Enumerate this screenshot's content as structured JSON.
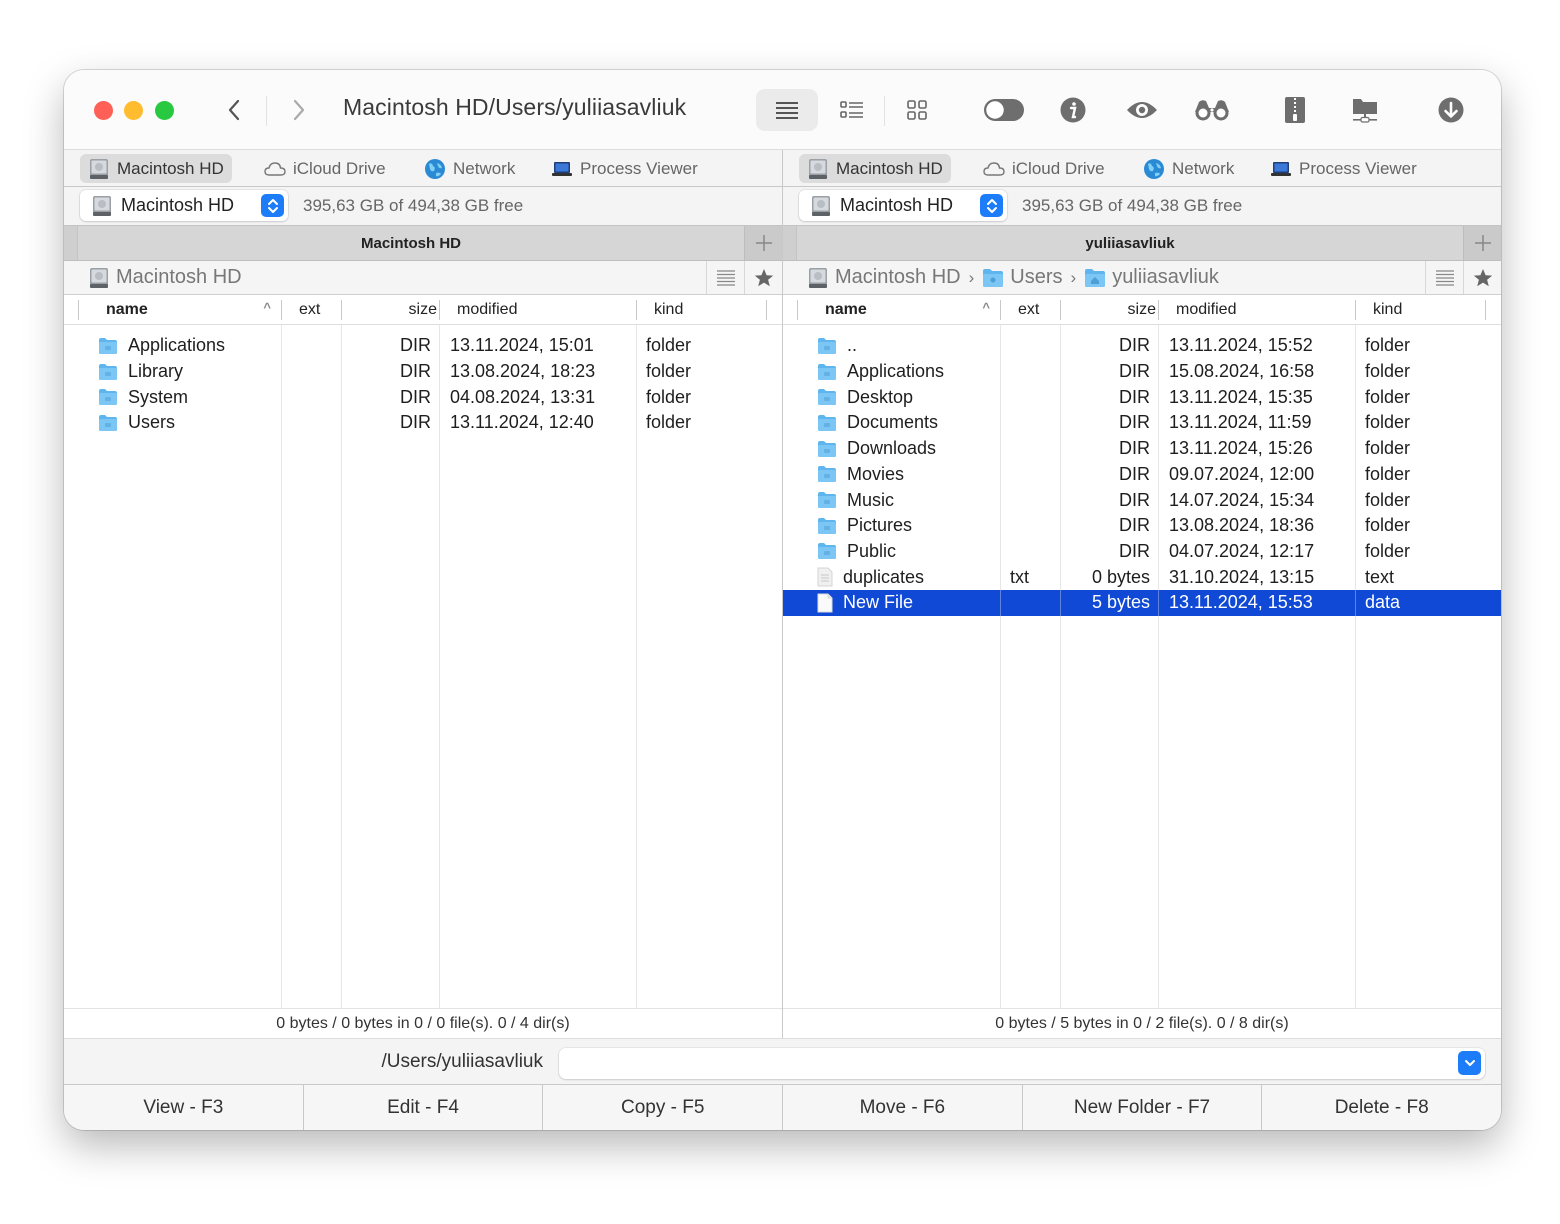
{
  "window": {
    "title_path": "Macintosh HD/Users/yuliiasavliuk",
    "toolbar": [
      {
        "name": "view-brief-icon",
        "active": true
      },
      {
        "name": "view-detailed-icon",
        "active": false
      },
      {
        "name": "view-thumbnails-icon",
        "active": false
      },
      {
        "name": "toggle-hidden-icon",
        "active": false
      },
      {
        "name": "info-icon",
        "active": false
      },
      {
        "name": "quick-look-icon",
        "active": false
      },
      {
        "name": "binoculars-search-icon",
        "active": false
      },
      {
        "name": "archive-icon",
        "active": false
      },
      {
        "name": "network-share-icon",
        "active": false
      },
      {
        "name": "download-icon",
        "active": false
      }
    ]
  },
  "panes": {
    "left": {
      "drive_tabs": [
        {
          "label": "Macintosh HD",
          "icon": "disk-icon",
          "active": true
        },
        {
          "label": "iCloud Drive",
          "icon": "cloud-icon",
          "active": false
        },
        {
          "label": "Network",
          "icon": "globe-icon",
          "active": false
        },
        {
          "label": "Process Viewer",
          "icon": "laptop-icon",
          "active": false
        }
      ],
      "volume": {
        "name": "Macintosh HD",
        "free": "395,63 GB of 494,38 GB free"
      },
      "tab_title": "Macintosh HD",
      "breadcrumb": [
        {
          "label": "Macintosh HD",
          "icon": "disk-icon"
        }
      ],
      "columns": {
        "name": "name",
        "ext": "ext",
        "size": "size",
        "modified": "modified",
        "kind": "kind"
      },
      "rows": [
        {
          "name": "Applications",
          "ext": "",
          "size": "DIR",
          "modified": "13.11.2024, 15:01",
          "kind": "folder",
          "icon": "folder-icon",
          "selected": false
        },
        {
          "name": "Library",
          "ext": "",
          "size": "DIR",
          "modified": "13.08.2024, 18:23",
          "kind": "folder",
          "icon": "folder-icon",
          "selected": false
        },
        {
          "name": "System",
          "ext": "",
          "size": "DIR",
          "modified": "04.08.2024, 13:31",
          "kind": "folder",
          "icon": "folder-icon",
          "selected": false
        },
        {
          "name": "Users",
          "ext": "",
          "size": "DIR",
          "modified": "13.11.2024, 12:40",
          "kind": "folder",
          "icon": "folder-icon",
          "selected": false
        }
      ],
      "status": "0 bytes / 0 bytes in 0 / 0 file(s). 0 / 4 dir(s)"
    },
    "right": {
      "drive_tabs": [
        {
          "label": "Macintosh HD",
          "icon": "disk-icon",
          "active": true
        },
        {
          "label": "iCloud Drive",
          "icon": "cloud-icon",
          "active": false
        },
        {
          "label": "Network",
          "icon": "globe-icon",
          "active": false
        },
        {
          "label": "Process Viewer",
          "icon": "laptop-icon",
          "active": false
        }
      ],
      "volume": {
        "name": "Macintosh HD",
        "free": "395,63 GB of 494,38 GB free"
      },
      "tab_title": "yuliiasavliuk",
      "breadcrumb": [
        {
          "label": "Macintosh HD",
          "icon": "disk-icon"
        },
        {
          "label": "Users",
          "icon": "folder-icon"
        },
        {
          "label": "yuliiasavliuk",
          "icon": "folder-icon"
        }
      ],
      "columns": {
        "name": "name",
        "ext": "ext",
        "size": "size",
        "modified": "modified",
        "kind": "kind"
      },
      "rows": [
        {
          "name": "..",
          "ext": "",
          "size": "DIR",
          "modified": "13.11.2024, 15:52",
          "kind": "folder",
          "icon": "folder-icon",
          "selected": false
        },
        {
          "name": "Applications",
          "ext": "",
          "size": "DIR",
          "modified": "15.08.2024, 16:58",
          "kind": "folder",
          "icon": "folder-icon",
          "selected": false
        },
        {
          "name": "Desktop",
          "ext": "",
          "size": "DIR",
          "modified": "13.11.2024, 15:35",
          "kind": "folder",
          "icon": "folder-icon",
          "selected": false
        },
        {
          "name": "Documents",
          "ext": "",
          "size": "DIR",
          "modified": "13.11.2024, 11:59",
          "kind": "folder",
          "icon": "folder-icon",
          "selected": false
        },
        {
          "name": "Downloads",
          "ext": "",
          "size": "DIR",
          "modified": "13.11.2024, 15:26",
          "kind": "folder",
          "icon": "folder-icon",
          "selected": false
        },
        {
          "name": "Movies",
          "ext": "",
          "size": "DIR",
          "modified": "09.07.2024, 12:00",
          "kind": "folder",
          "icon": "folder-icon",
          "selected": false
        },
        {
          "name": "Music",
          "ext": "",
          "size": "DIR",
          "modified": "14.07.2024, 15:34",
          "kind": "folder",
          "icon": "folder-icon",
          "selected": false
        },
        {
          "name": "Pictures",
          "ext": "",
          "size": "DIR",
          "modified": "13.08.2024, 18:36",
          "kind": "folder",
          "icon": "folder-icon",
          "selected": false
        },
        {
          "name": "Public",
          "ext": "",
          "size": "DIR",
          "modified": "04.07.2024, 12:17",
          "kind": "folder",
          "icon": "folder-icon",
          "selected": false
        },
        {
          "name": "duplicates",
          "ext": "txt",
          "size": "0 bytes",
          "modified": "31.10.2024, 13:15",
          "kind": "text",
          "icon": "text-file-icon",
          "selected": false
        },
        {
          "name": "New File",
          "ext": "",
          "size": "5 bytes",
          "modified": "13.11.2024, 15:53",
          "kind": "data",
          "icon": "file-icon",
          "selected": true
        }
      ],
      "status": "0 bytes / 5 bytes in 0 / 2 file(s). 0 / 8 dir(s)"
    }
  },
  "command_line": {
    "path": "/Users/yuliiasavliuk",
    "value": "",
    "placeholder": ""
  },
  "function_keys": [
    {
      "label": "View - F3"
    },
    {
      "label": "Edit - F4"
    },
    {
      "label": "Copy - F5"
    },
    {
      "label": "Move - F6"
    },
    {
      "label": "New Folder - F7"
    },
    {
      "label": "Delete - F8"
    }
  ],
  "colors": {
    "selection": "#0f49d5",
    "accent": "#1d7cf7",
    "folder": "#5fb6ef",
    "close": "#fe5f57",
    "minimize": "#febc2e",
    "maximize": "#28c840"
  }
}
